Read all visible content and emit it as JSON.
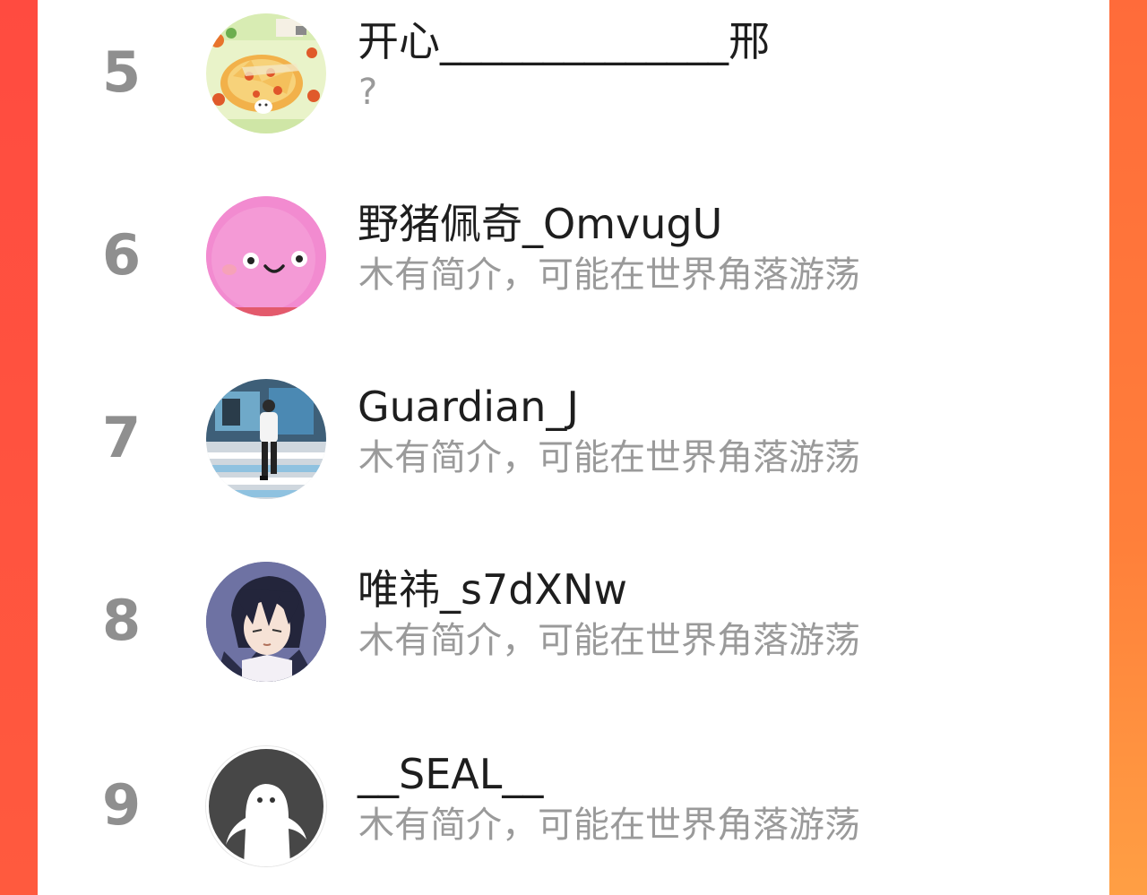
{
  "colors": {
    "accent_background": "#ff5a3e",
    "panel": "#ffffff",
    "rank_text": "#8f8f8f",
    "name_text": "#1e1e1e",
    "bio_text": "#9a9a9a"
  },
  "users": [
    {
      "rank": "5",
      "name": "开心______________邢",
      "bio": "?",
      "avatar_icon": "pizza-illustration-avatar-icon"
    },
    {
      "rank": "6",
      "name": "野猪佩奇_OmvugU",
      "bio": "木有简介，可能在世界角落游荡",
      "avatar_icon": "pink-smiley-avatar-icon"
    },
    {
      "rank": "7",
      "name": "Guardian_J",
      "bio": "木有简介，可能在世界角落游荡",
      "avatar_icon": "crosswalk-photo-avatar-icon"
    },
    {
      "rank": "8",
      "name": "唯祎_s7dXNw",
      "bio": "木有简介，可能在世界角落游荡",
      "avatar_icon": "anime-boy-avatar-icon"
    },
    {
      "rank": "9",
      "name": "__SEAL__",
      "bio": "木有简介，可能在世界角落游荡",
      "avatar_icon": "default-ghost-avatar-icon"
    }
  ]
}
